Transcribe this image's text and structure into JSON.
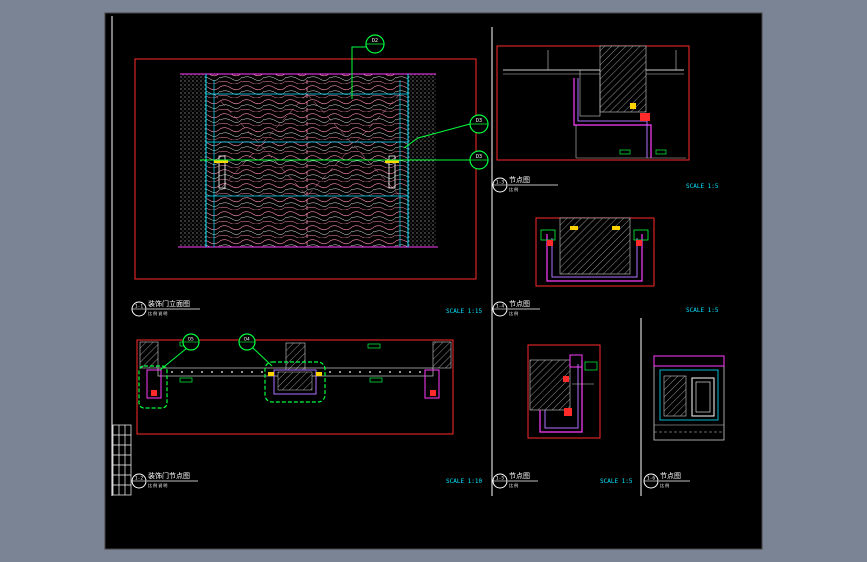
{
  "colors": {
    "background": "#7b8494",
    "paper": "#000000",
    "frame": "#ffffff",
    "outline": "#ff2a2a",
    "leader": "#00ff3c",
    "dimension": "#00e5ff",
    "wood": "#ff7f9f",
    "stone": "#c8c8c8",
    "trim": "#ff3cff",
    "detail": "#b070ff"
  },
  "markers": {
    "d2_top": "D2",
    "d3": "D3",
    "d3b": "D3",
    "d5": "D5",
    "d4": "D4"
  },
  "titles": {
    "elevation": {
      "num": "1-1",
      "title": "装饰门立面图",
      "sub": "比 例 说 明"
    },
    "plan": {
      "num": "1-2",
      "title": "装饰门节点图",
      "sub": "比 例 说 明"
    },
    "d1": {
      "num": "1-3",
      "title": "节点图",
      "sub": "比 例"
    },
    "d2": {
      "num": "1-4",
      "title": "节点图",
      "sub": "比 例"
    },
    "d3": {
      "num": "1-5",
      "title": "节点图",
      "sub": "比 例"
    },
    "d4": {
      "num": "1-6",
      "title": "节点图",
      "sub": "比 例"
    }
  },
  "scales": {
    "elevation": "SCALE 1:15",
    "plan": "SCALE 1:10",
    "d1": "SCALE 1:5",
    "d2": "SCALE 1:5",
    "d3": "SCALE 1:5"
  }
}
